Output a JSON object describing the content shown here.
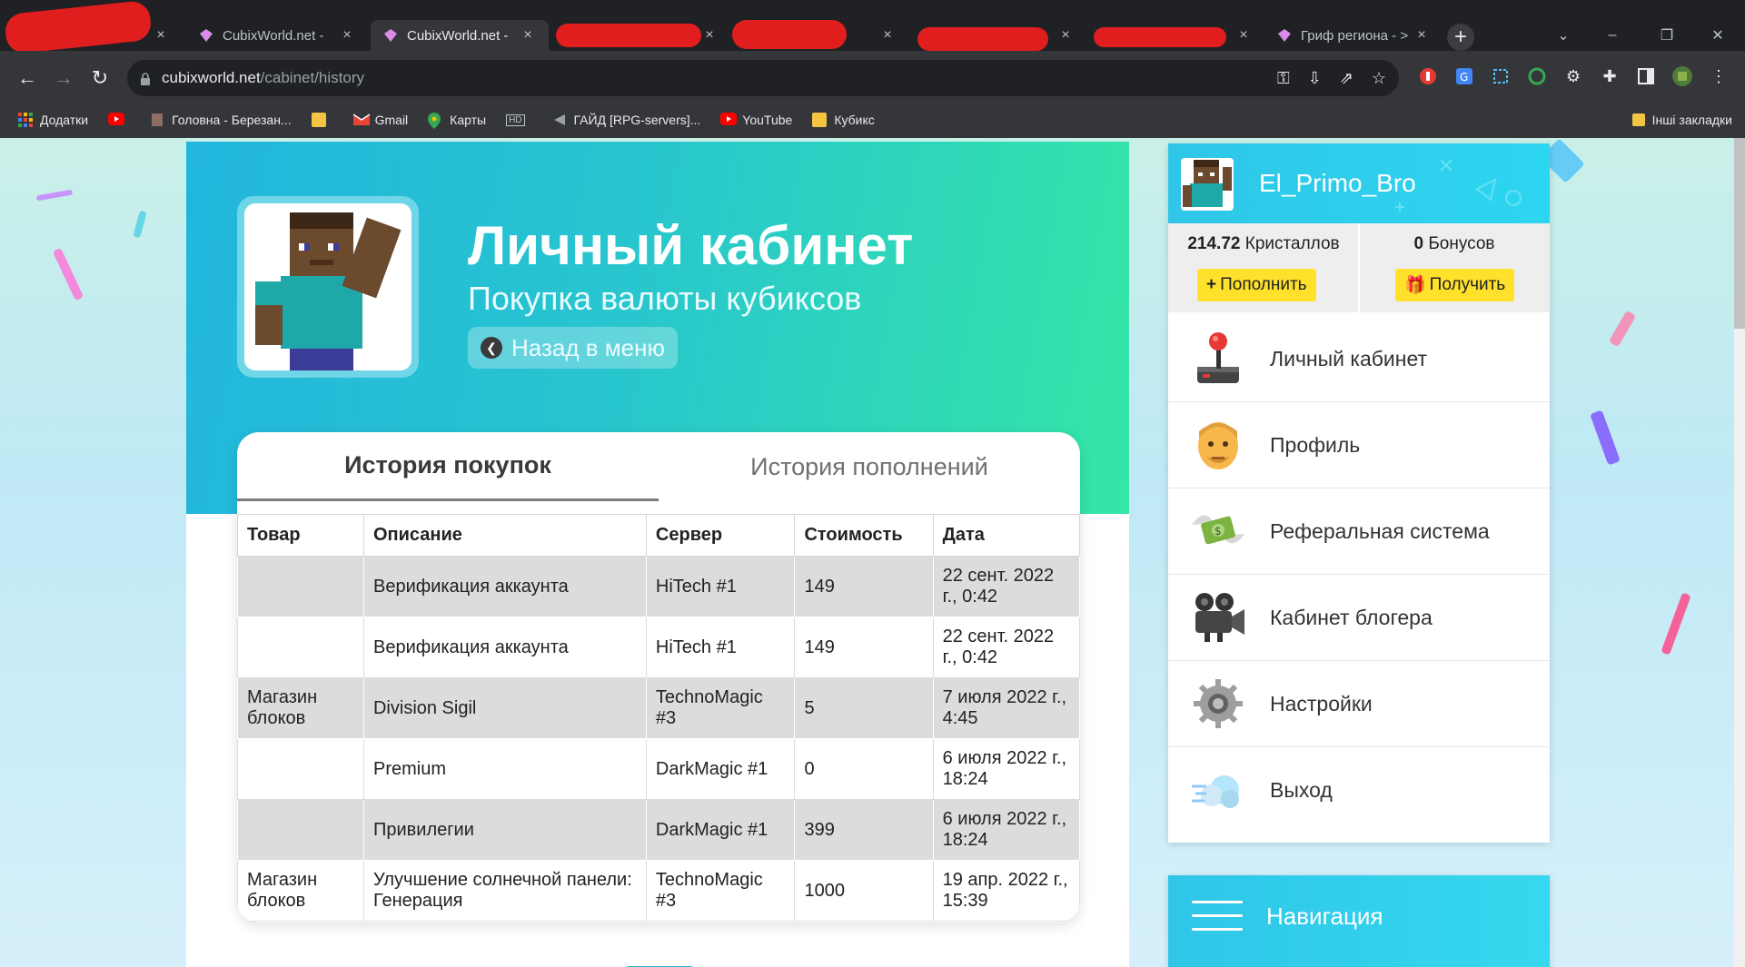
{
  "browser": {
    "tabs": [
      {
        "title": "",
        "redacted": true
      },
      {
        "title": "CubixWorld.net -"
      },
      {
        "title": "CubixWorld.net -",
        "active": true
      },
      {
        "title": "",
        "redacted": true
      },
      {
        "title": "",
        "redacted": true
      },
      {
        "title": "",
        "redacted": true
      },
      {
        "title": "",
        "redacted": true
      },
      {
        "title": "Гриф региона - >"
      }
    ],
    "tab_close": "×",
    "new_tab": "+",
    "url_host": "cubixworld.net",
    "url_path": "/cabinet/history",
    "bookmarks": [
      {
        "label": "Додатки",
        "icon": "apps-icon"
      },
      {
        "label": "",
        "icon": "youtube-icon"
      },
      {
        "label": "Головна - Березан...",
        "icon": "page-icon"
      },
      {
        "label": "",
        "icon": "folder-icon"
      },
      {
        "label": "Gmail",
        "icon": "gmail-icon"
      },
      {
        "label": "Карты",
        "icon": "maps-icon"
      },
      {
        "label": "",
        "icon": "hd-icon"
      },
      {
        "label": "ГАЙД [RPG-servers]...",
        "icon": "page-icon"
      },
      {
        "label": "YouTube",
        "icon": "youtube-icon"
      },
      {
        "label": "Кубикс",
        "icon": "folder-icon"
      }
    ],
    "other_bookmarks": "Інші закладки"
  },
  "hero": {
    "title": "Личный кабинет",
    "subtitle": "Покупка валюты кубиксов",
    "back_button": "Назад в меню"
  },
  "history": {
    "tabs": [
      "История покупок",
      "История пополнений"
    ],
    "columns": [
      "Товар",
      "Описание",
      "Сервер",
      "Стоимость",
      "Дата"
    ],
    "rows": [
      [
        "",
        "Верификация аккаунта",
        "HiTech #1",
        "149",
        "22 сент. 2022 г., 0:42"
      ],
      [
        "",
        "Верификация аккаунта",
        "HiTech #1",
        "149",
        "22 сент. 2022 г., 0:42"
      ],
      [
        "Магазин блоков",
        "Division Sigil",
        "TechnoMagic #3",
        "5",
        "7 июля 2022 г., 4:45"
      ],
      [
        "",
        "Premium",
        "DarkMagic #1",
        "0",
        "6 июля 2022 г., 18:24"
      ],
      [
        "",
        "Привилегии",
        "DarkMagic #1",
        "399",
        "6 июля 2022 г., 18:24"
      ],
      [
        "Магазин блоков",
        "Улучшение солнечной панели: Генерация",
        "TechnoMagic #3",
        "1000",
        "19 апр. 2022 г., 15:39"
      ]
    ]
  },
  "sidebar": {
    "username": "El_Primo_Bro",
    "crystals_value": "214.72",
    "crystals_label": "Кристаллов",
    "bonus_value": "0",
    "bonus_label": "Бонусов",
    "topup_button": "Пополнить",
    "get_button": "Получить",
    "menu": [
      {
        "label": "Личный кабинет",
        "icon": "joystick-icon"
      },
      {
        "label": "Профиль",
        "icon": "face-icon"
      },
      {
        "label": "Реферальная система",
        "icon": "money-wings-icon"
      },
      {
        "label": "Кабинет блогера",
        "icon": "movie-camera-icon"
      },
      {
        "label": "Настройки",
        "icon": "gear-icon"
      },
      {
        "label": "Выход",
        "icon": "dash-cloud-icon"
      }
    ],
    "navigation_title": "Навигация"
  },
  "colors": {
    "hero_start": "#22b6dd",
    "hero_end": "#35e6a6",
    "button_yellow": "#ffe12b",
    "sidebar_head": "#2fc6e8"
  }
}
